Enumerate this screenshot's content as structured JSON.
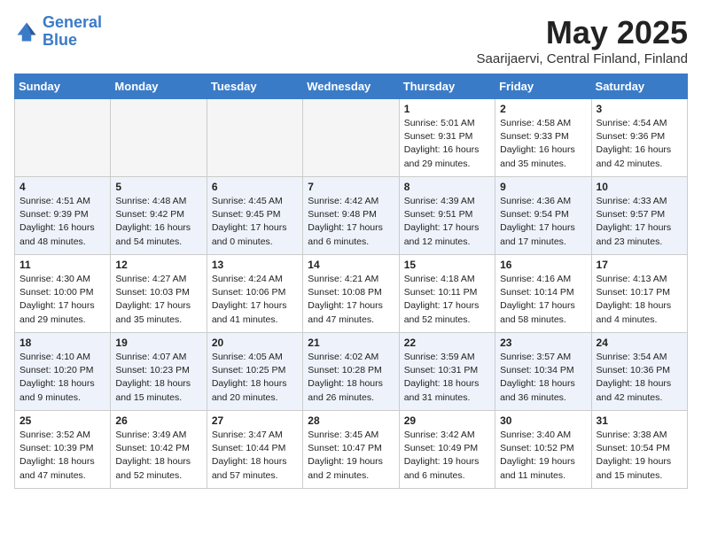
{
  "header": {
    "logo_line1": "General",
    "logo_line2": "Blue",
    "month": "May 2025",
    "location": "Saarijaervi, Central Finland, Finland"
  },
  "weekdays": [
    "Sunday",
    "Monday",
    "Tuesday",
    "Wednesday",
    "Thursday",
    "Friday",
    "Saturday"
  ],
  "weeks": [
    [
      {
        "day": "",
        "text": ""
      },
      {
        "day": "",
        "text": ""
      },
      {
        "day": "",
        "text": ""
      },
      {
        "day": "",
        "text": ""
      },
      {
        "day": "1",
        "text": "Sunrise: 5:01 AM\nSunset: 9:31 PM\nDaylight: 16 hours\nand 29 minutes."
      },
      {
        "day": "2",
        "text": "Sunrise: 4:58 AM\nSunset: 9:33 PM\nDaylight: 16 hours\nand 35 minutes."
      },
      {
        "day": "3",
        "text": "Sunrise: 4:54 AM\nSunset: 9:36 PM\nDaylight: 16 hours\nand 42 minutes."
      }
    ],
    [
      {
        "day": "4",
        "text": "Sunrise: 4:51 AM\nSunset: 9:39 PM\nDaylight: 16 hours\nand 48 minutes."
      },
      {
        "day": "5",
        "text": "Sunrise: 4:48 AM\nSunset: 9:42 PM\nDaylight: 16 hours\nand 54 minutes."
      },
      {
        "day": "6",
        "text": "Sunrise: 4:45 AM\nSunset: 9:45 PM\nDaylight: 17 hours\nand 0 minutes."
      },
      {
        "day": "7",
        "text": "Sunrise: 4:42 AM\nSunset: 9:48 PM\nDaylight: 17 hours\nand 6 minutes."
      },
      {
        "day": "8",
        "text": "Sunrise: 4:39 AM\nSunset: 9:51 PM\nDaylight: 17 hours\nand 12 minutes."
      },
      {
        "day": "9",
        "text": "Sunrise: 4:36 AM\nSunset: 9:54 PM\nDaylight: 17 hours\nand 17 minutes."
      },
      {
        "day": "10",
        "text": "Sunrise: 4:33 AM\nSunset: 9:57 PM\nDaylight: 17 hours\nand 23 minutes."
      }
    ],
    [
      {
        "day": "11",
        "text": "Sunrise: 4:30 AM\nSunset: 10:00 PM\nDaylight: 17 hours\nand 29 minutes."
      },
      {
        "day": "12",
        "text": "Sunrise: 4:27 AM\nSunset: 10:03 PM\nDaylight: 17 hours\nand 35 minutes."
      },
      {
        "day": "13",
        "text": "Sunrise: 4:24 AM\nSunset: 10:06 PM\nDaylight: 17 hours\nand 41 minutes."
      },
      {
        "day": "14",
        "text": "Sunrise: 4:21 AM\nSunset: 10:08 PM\nDaylight: 17 hours\nand 47 minutes."
      },
      {
        "day": "15",
        "text": "Sunrise: 4:18 AM\nSunset: 10:11 PM\nDaylight: 17 hours\nand 52 minutes."
      },
      {
        "day": "16",
        "text": "Sunrise: 4:16 AM\nSunset: 10:14 PM\nDaylight: 17 hours\nand 58 minutes."
      },
      {
        "day": "17",
        "text": "Sunrise: 4:13 AM\nSunset: 10:17 PM\nDaylight: 18 hours\nand 4 minutes."
      }
    ],
    [
      {
        "day": "18",
        "text": "Sunrise: 4:10 AM\nSunset: 10:20 PM\nDaylight: 18 hours\nand 9 minutes."
      },
      {
        "day": "19",
        "text": "Sunrise: 4:07 AM\nSunset: 10:23 PM\nDaylight: 18 hours\nand 15 minutes."
      },
      {
        "day": "20",
        "text": "Sunrise: 4:05 AM\nSunset: 10:25 PM\nDaylight: 18 hours\nand 20 minutes."
      },
      {
        "day": "21",
        "text": "Sunrise: 4:02 AM\nSunset: 10:28 PM\nDaylight: 18 hours\nand 26 minutes."
      },
      {
        "day": "22",
        "text": "Sunrise: 3:59 AM\nSunset: 10:31 PM\nDaylight: 18 hours\nand 31 minutes."
      },
      {
        "day": "23",
        "text": "Sunrise: 3:57 AM\nSunset: 10:34 PM\nDaylight: 18 hours\nand 36 minutes."
      },
      {
        "day": "24",
        "text": "Sunrise: 3:54 AM\nSunset: 10:36 PM\nDaylight: 18 hours\nand 42 minutes."
      }
    ],
    [
      {
        "day": "25",
        "text": "Sunrise: 3:52 AM\nSunset: 10:39 PM\nDaylight: 18 hours\nand 47 minutes."
      },
      {
        "day": "26",
        "text": "Sunrise: 3:49 AM\nSunset: 10:42 PM\nDaylight: 18 hours\nand 52 minutes."
      },
      {
        "day": "27",
        "text": "Sunrise: 3:47 AM\nSunset: 10:44 PM\nDaylight: 18 hours\nand 57 minutes."
      },
      {
        "day": "28",
        "text": "Sunrise: 3:45 AM\nSunset: 10:47 PM\nDaylight: 19 hours\nand 2 minutes."
      },
      {
        "day": "29",
        "text": "Sunrise: 3:42 AM\nSunset: 10:49 PM\nDaylight: 19 hours\nand 6 minutes."
      },
      {
        "day": "30",
        "text": "Sunrise: 3:40 AM\nSunset: 10:52 PM\nDaylight: 19 hours\nand 11 minutes."
      },
      {
        "day": "31",
        "text": "Sunrise: 3:38 AM\nSunset: 10:54 PM\nDaylight: 19 hours\nand 15 minutes."
      }
    ]
  ]
}
